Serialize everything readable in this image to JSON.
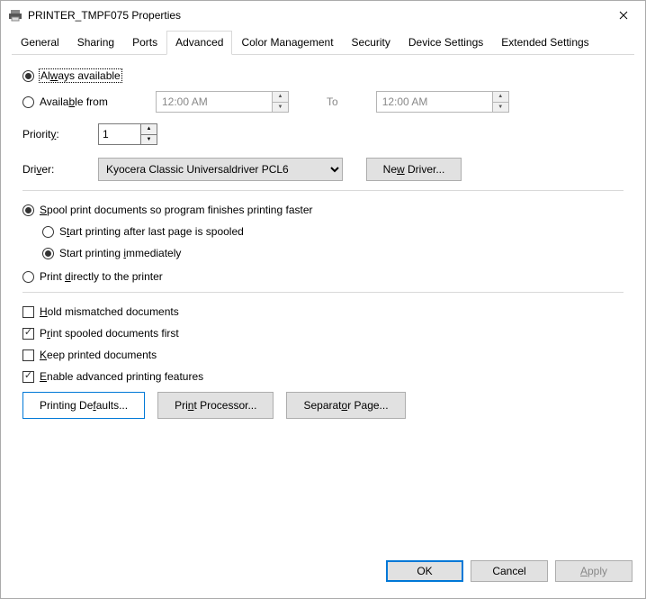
{
  "window": {
    "title": "PRINTER_TMPF075 Properties"
  },
  "tabs": [
    "General",
    "Sharing",
    "Ports",
    "Advanced",
    "Color Management",
    "Security",
    "Device Settings",
    "Extended Settings"
  ],
  "active_tab": "Advanced",
  "availability": {
    "always_label_pre": "Al",
    "always_label_u": "w",
    "always_label_post": "ays available",
    "from_label_pre": "Availa",
    "from_label_u": "b",
    "from_label_post": "le from",
    "from_time": "12:00 AM",
    "to_label": "To",
    "to_time": "12:00 AM",
    "selected": "always"
  },
  "priority": {
    "label_pre": "Priorit",
    "label_u": "y",
    "label_post": ":",
    "value": "1"
  },
  "driver": {
    "label_pre": "Dri",
    "label_u": "v",
    "label_post": "er:",
    "value": "Kyocera Classic Universaldriver PCL6",
    "new_btn_pre": "Ne",
    "new_btn_u": "w",
    "new_btn_post": " Driver..."
  },
  "spool": {
    "group_pre": "",
    "group_u": "S",
    "group_post": "pool print documents so program finishes printing faster",
    "after_pre": "S",
    "after_u": "t",
    "after_post": "art printing after last page is spooled",
    "imm_pre": "Start printing ",
    "imm_u": "i",
    "imm_post": "mmediately",
    "direct_pre": "Print ",
    "direct_u": "d",
    "direct_post": "irectly to the printer",
    "group_sel": "spool",
    "sub_sel": "immediately"
  },
  "opts": {
    "hold_pre": "",
    "hold_u": "H",
    "hold_post": "old mismatched documents",
    "hold": false,
    "first_pre": "P",
    "first_u": "r",
    "first_post": "int spooled documents first",
    "first": true,
    "keep_pre": "",
    "keep_u": "K",
    "keep_post": "eep printed documents",
    "keep": false,
    "adv_pre": "",
    "adv_u": "E",
    "adv_post": "nable advanced printing features",
    "adv": true
  },
  "buttons": {
    "defaults_pre": "Printing De",
    "defaults_u": "f",
    "defaults_post": "aults...",
    "processor_pre": "Pri",
    "processor_u": "n",
    "processor_post": "t Processor...",
    "separator_pre": "Separat",
    "separator_u": "o",
    "separator_post": "r Page..."
  },
  "footer": {
    "ok": "OK",
    "cancel": "Cancel",
    "apply_u": "A",
    "apply_post": "pply"
  }
}
